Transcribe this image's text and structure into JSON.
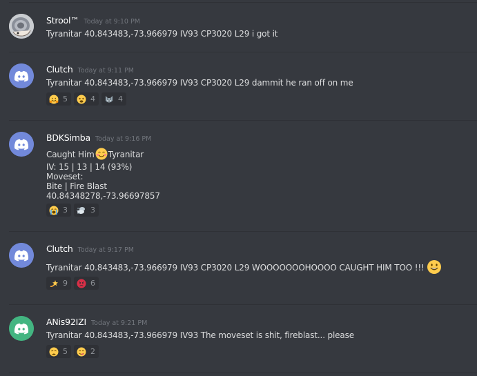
{
  "messages": [
    {
      "username": "Strool™",
      "timestamp": "Today at 9:10 PM",
      "lines": [
        "Tyranitar 40.843483,-73.966979 IV93 CP3020 L29 i got it"
      ],
      "reactions": []
    },
    {
      "username": "Clutch",
      "timestamp": "Today at 9:11 PM",
      "lines": [
        "Tyranitar 40.843483,-73.966979 IV93 CP3020 L29 dammit he ran off on me"
      ],
      "reactions": [
        {
          "emoji": "hugging-face",
          "count": "5"
        },
        {
          "emoji": "tired-face",
          "count": "4"
        },
        {
          "emoji": "wolf-face",
          "count": "4"
        }
      ]
    },
    {
      "username": "BDKSimba",
      "timestamp": "Today at 9:16 PM",
      "lines": [
        {
          "before": "Caught Him",
          "emoji": "blush",
          "after": "Tyranitar"
        },
        "IV: 15 | 13 | 14 (93%)",
        "Moveset:",
        "Bite | Fire Blast",
        "40.84348278,-73.96697857"
      ],
      "reactions": [
        {
          "emoji": "sob",
          "count": "3"
        },
        {
          "emoji": "dash",
          "count": "3"
        }
      ]
    },
    {
      "username": "Clutch",
      "timestamp": "Today at 9:17 PM",
      "lines": [
        {
          "text": "Tyranitar 40.843483,-73.966979 IV93 CP3020 L29 WOOOOOOOHOOOO CAUGHT HIM TOO !!!",
          "emoji": "smiley"
        }
      ],
      "reactions": [
        {
          "emoji": "dizzy",
          "count": "9"
        },
        {
          "emoji": "rage",
          "count": "6"
        }
      ]
    },
    {
      "username": "ANis92IZI",
      "timestamp": "Today at 9:21 PM",
      "lines": [
        "Tyranitar 40.843483,-73.966979 IV93 The moveset is shit, fireblast... please"
      ],
      "reactions": [
        {
          "emoji": "weary",
          "count": "5"
        },
        {
          "emoji": "yum",
          "count": "2"
        }
      ]
    }
  ],
  "colors": {
    "background": "#36393f",
    "reaction_bg": "#2f3136",
    "discord_blurple": "#7289da",
    "discord_green": "#43b581",
    "username": "#ffffff",
    "timestamp": "#72767d",
    "text": "#dcddde"
  }
}
